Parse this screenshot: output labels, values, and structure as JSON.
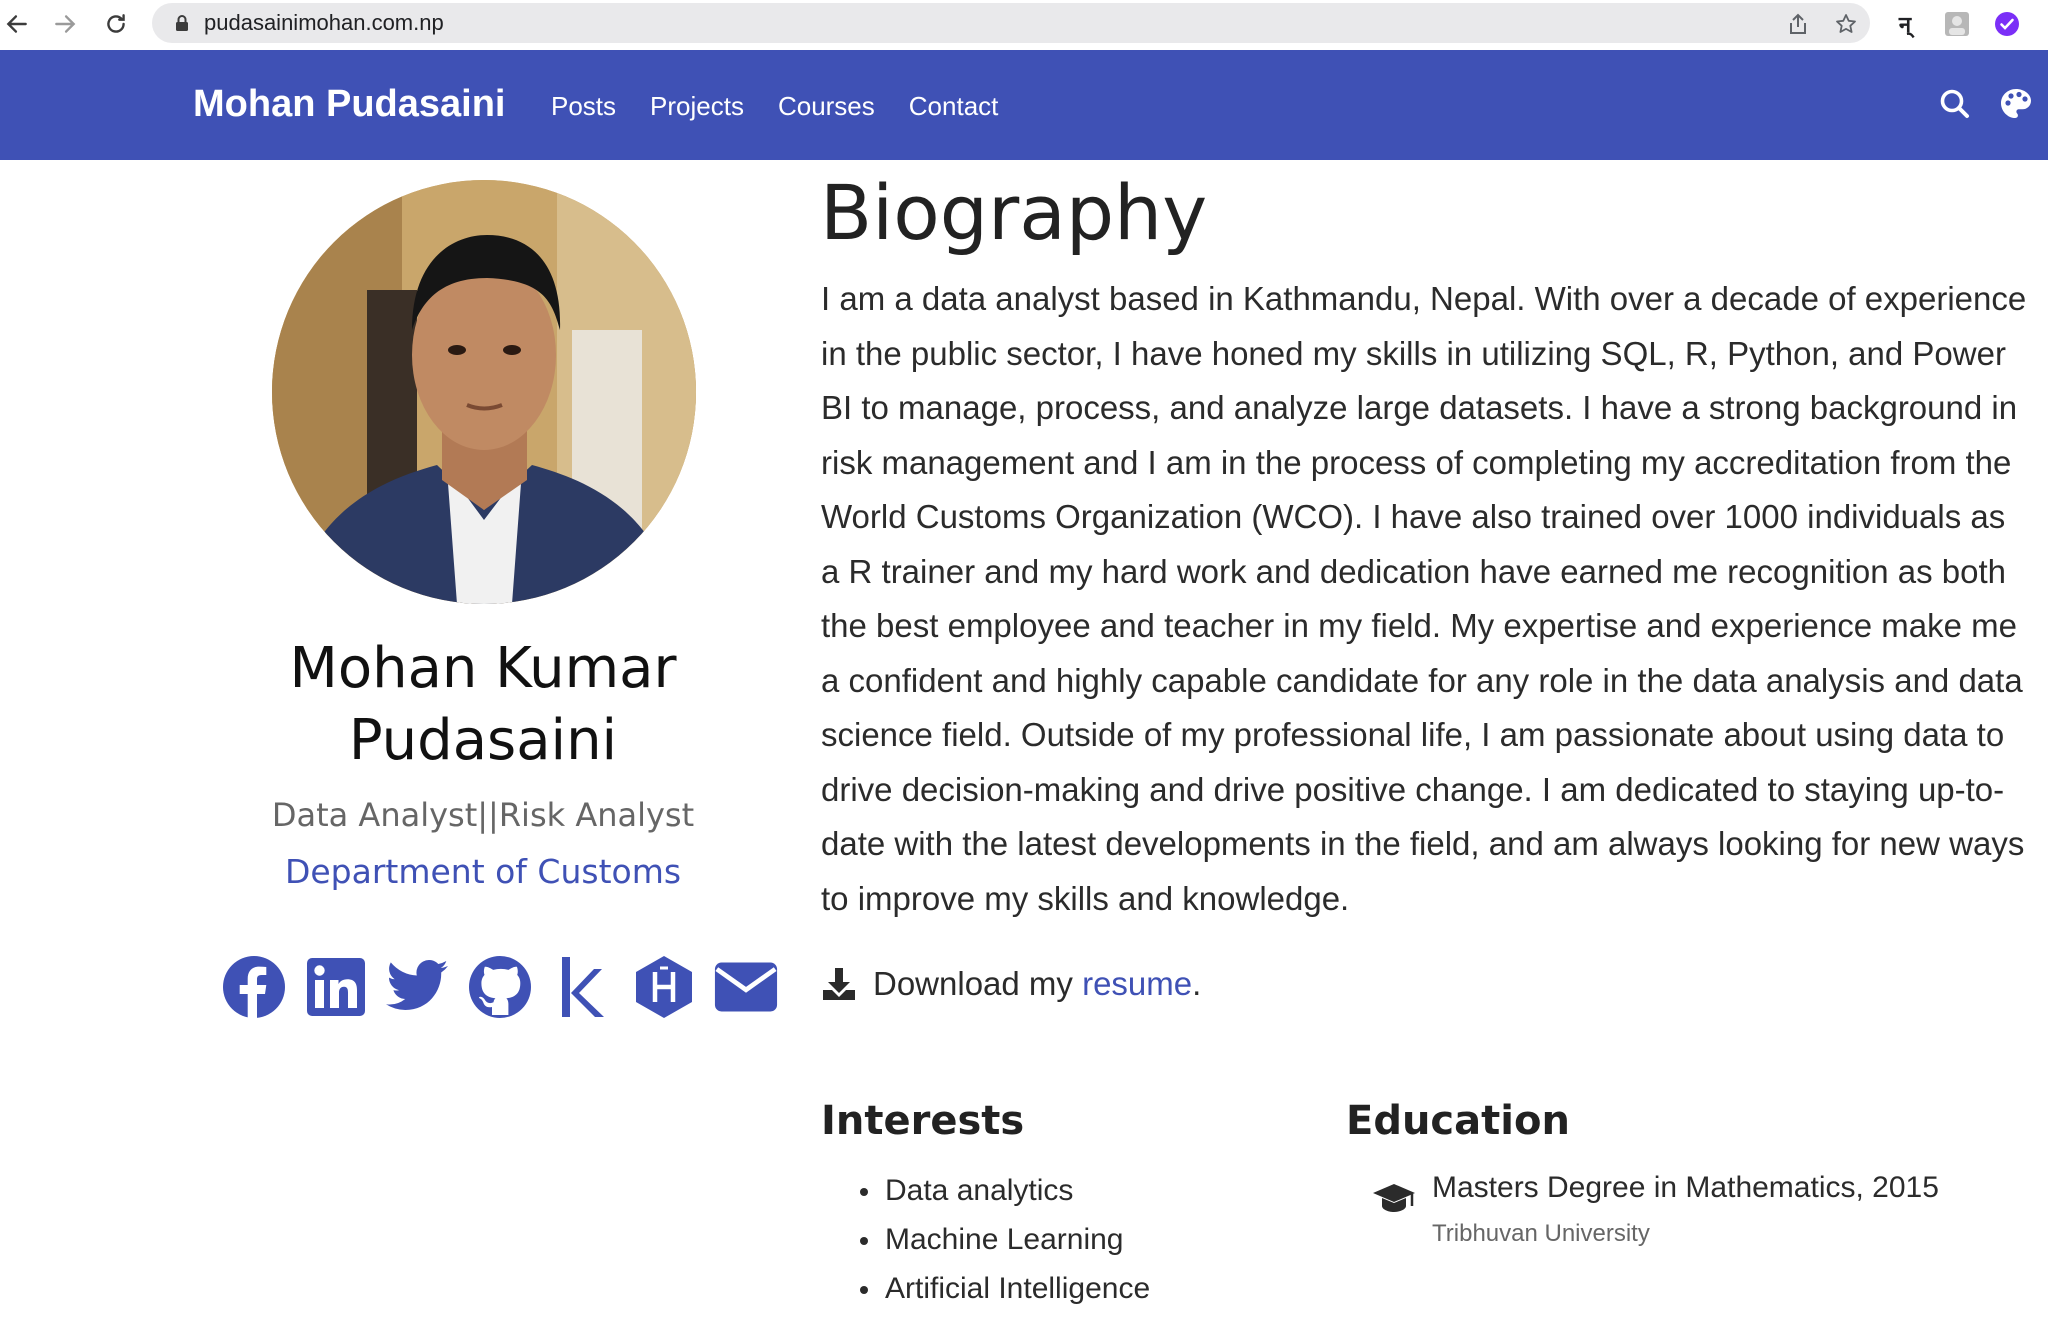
{
  "browser": {
    "url": "pudasainimohan.com.np",
    "icons": [
      "back-arrow-icon",
      "forward-arrow-icon",
      "reload-icon",
      "lock-icon",
      "share-icon",
      "bookmark-star-icon",
      "extension-icon",
      "profile-icon",
      "extension-check-icon"
    ],
    "ext_glyph": "न्"
  },
  "site": {
    "brand": "Mohan Pudasaini",
    "menu": [
      "Posts",
      "Projects",
      "Courses",
      "Contact"
    ],
    "accent_color": "#3f51b5"
  },
  "profile": {
    "name": "Mohan Kumar Pudasaini",
    "role": "Data Analyst||Risk Analyst",
    "organization": "Department of Customs",
    "social_icons": [
      "facebook-icon",
      "linkedin-icon",
      "twitter-icon",
      "github-icon",
      "kaggle-icon",
      "hashnode-icon",
      "email-icon"
    ]
  },
  "biography": {
    "title": "Biography",
    "text": "I am a data analyst based in Kathmandu, Nepal. With over a decade of experience in the public sector, I have honed my skills in utilizing SQL, R, Python, and Power BI to manage, process, and analyze large datasets. I have a strong background in risk management and I am in the process of completing my accreditation from the World Customs Organization (WCO). I have also trained over 1000 individuals as a R trainer and my hard work and dedication have earned me recognition as both the best employee and teacher in my field. My expertise and experience make me a confident and highly capable candidate for any role in the data analysis and data science field. Outside of my professional life, I am passionate about using data to drive decision-making and drive positive change. I am dedicated to staying up-to-date with the latest developments in the field, and am always looking for new ways to improve my skills and knowledge.",
    "resume_prefix": "Download my ",
    "resume_link": "resume",
    "resume_suffix": "."
  },
  "interests": {
    "title": "Interests",
    "items": [
      "Data analytics",
      "Machine Learning",
      "Artificial Intelligence"
    ]
  },
  "education": {
    "title": "Education",
    "degree": "Masters Degree in Mathematics, 2015",
    "institution": "Tribhuvan University"
  }
}
